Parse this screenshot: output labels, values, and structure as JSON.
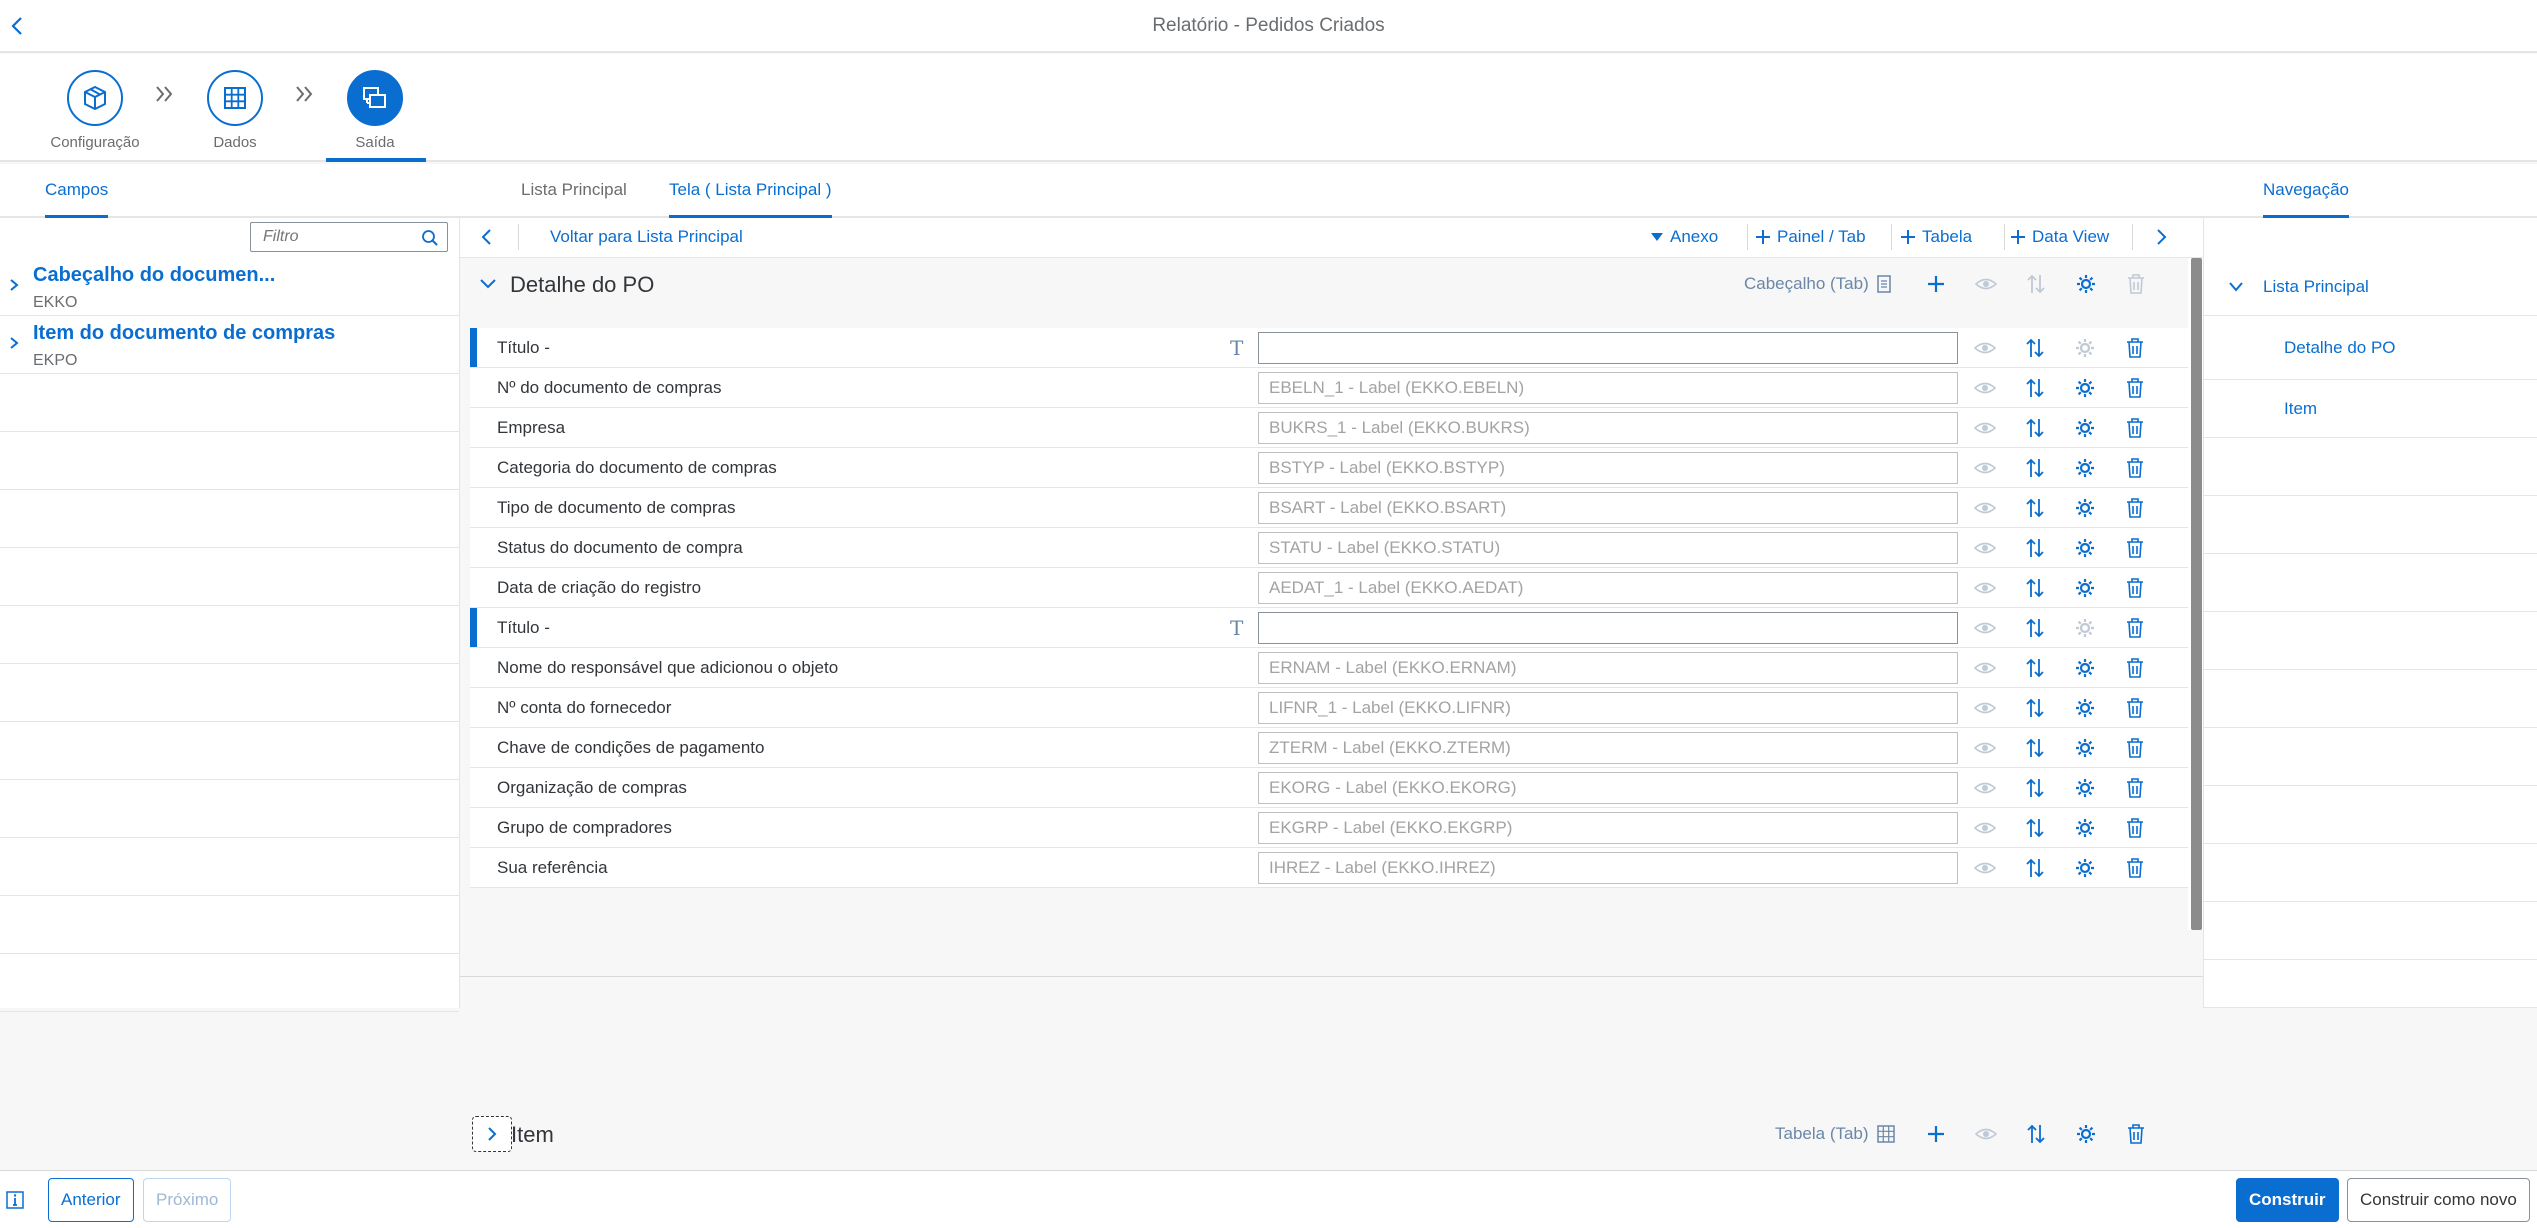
{
  "app": {
    "title": "Relatório - Pedidos Criados"
  },
  "colors": {
    "accent": "#0a6ed1",
    "text": "#32363a",
    "muted": "#6a6d70",
    "placeholder": "#a3a3a3"
  },
  "wizard": {
    "steps": [
      {
        "label": "Configuração",
        "icon": "cube-box-icon",
        "active": false
      },
      {
        "label": "Dados",
        "icon": "grid-table-icon",
        "active": false
      },
      {
        "label": "Saída",
        "icon": "output-screens-icon",
        "active": true
      }
    ]
  },
  "tabs": {
    "left": "Campos",
    "center": [
      {
        "label": "Lista Principal",
        "selected": false
      },
      {
        "label": "Tela ( Lista Principal )",
        "selected": true
      }
    ],
    "right": "Navegação"
  },
  "left": {
    "filter_placeholder": "Filtro",
    "groups": [
      {
        "title": "Cabeçalho do documen...",
        "subtitle": "EKKO"
      },
      {
        "title": "Item do documento de compras",
        "subtitle": "EKPO"
      }
    ]
  },
  "toolbar": {
    "back_label": "Voltar para Lista Principal",
    "anexo": "Anexo",
    "painel": "Painel / Tab",
    "tabela": "Tabela",
    "dataview": "Data View"
  },
  "detail": {
    "title": "Detalhe do PO",
    "tag": "Cabeçalho (Tab)",
    "fields": [
      {
        "label": "Título -",
        "value": "",
        "placeholder": "",
        "is_title": true
      },
      {
        "label": "Nº do documento de compras",
        "placeholder": "EBELN_1 - Label (EKKO.EBELN)",
        "is_title": false
      },
      {
        "label": "Empresa",
        "placeholder": "BUKRS_1 - Label (EKKO.BUKRS)",
        "is_title": false
      },
      {
        "label": "Categoria do documento de compras",
        "placeholder": "BSTYP - Label (EKKO.BSTYP)",
        "is_title": false
      },
      {
        "label": "Tipo de documento de compras",
        "placeholder": "BSART - Label (EKKO.BSART)",
        "is_title": false
      },
      {
        "label": "Status do documento de compra",
        "placeholder": "STATU - Label (EKKO.STATU)",
        "is_title": false
      },
      {
        "label": "Data de criação do registro",
        "placeholder": "AEDAT_1 - Label (EKKO.AEDAT)",
        "is_title": false
      },
      {
        "label": "Título -",
        "value": "",
        "placeholder": "",
        "is_title": true
      },
      {
        "label": "Nome do responsável que adicionou o objeto",
        "placeholder": "ERNAM - Label (EKKO.ERNAM)",
        "is_title": false
      },
      {
        "label": "Nº conta do fornecedor",
        "placeholder": "LIFNR_1 - Label (EKKO.LIFNR)",
        "is_title": false
      },
      {
        "label": "Chave de condições de pagamento",
        "placeholder": "ZTERM - Label (EKKO.ZTERM)",
        "is_title": false
      },
      {
        "label": "Organização de compras",
        "placeholder": "EKORG - Label (EKKO.EKORG)",
        "is_title": false
      },
      {
        "label": "Grupo de compradores",
        "placeholder": "EKGRP - Label (EKKO.EKGRP)",
        "is_title": false
      },
      {
        "label": "Sua referência",
        "placeholder": "IHREZ - Label (EKKO.IHREZ)",
        "is_title": false
      }
    ]
  },
  "item_section": {
    "title": "Item",
    "tag": "Tabela (Tab)"
  },
  "navigation": [
    {
      "label": "Lista Principal",
      "level": 0
    },
    {
      "label": "Detalhe do PO",
      "level": 1
    },
    {
      "label": "Item",
      "level": 1
    }
  ],
  "footer": {
    "anterior": "Anterior",
    "proximo": "Próximo",
    "construir": "Construir",
    "construir_novo": "Construir como novo"
  }
}
